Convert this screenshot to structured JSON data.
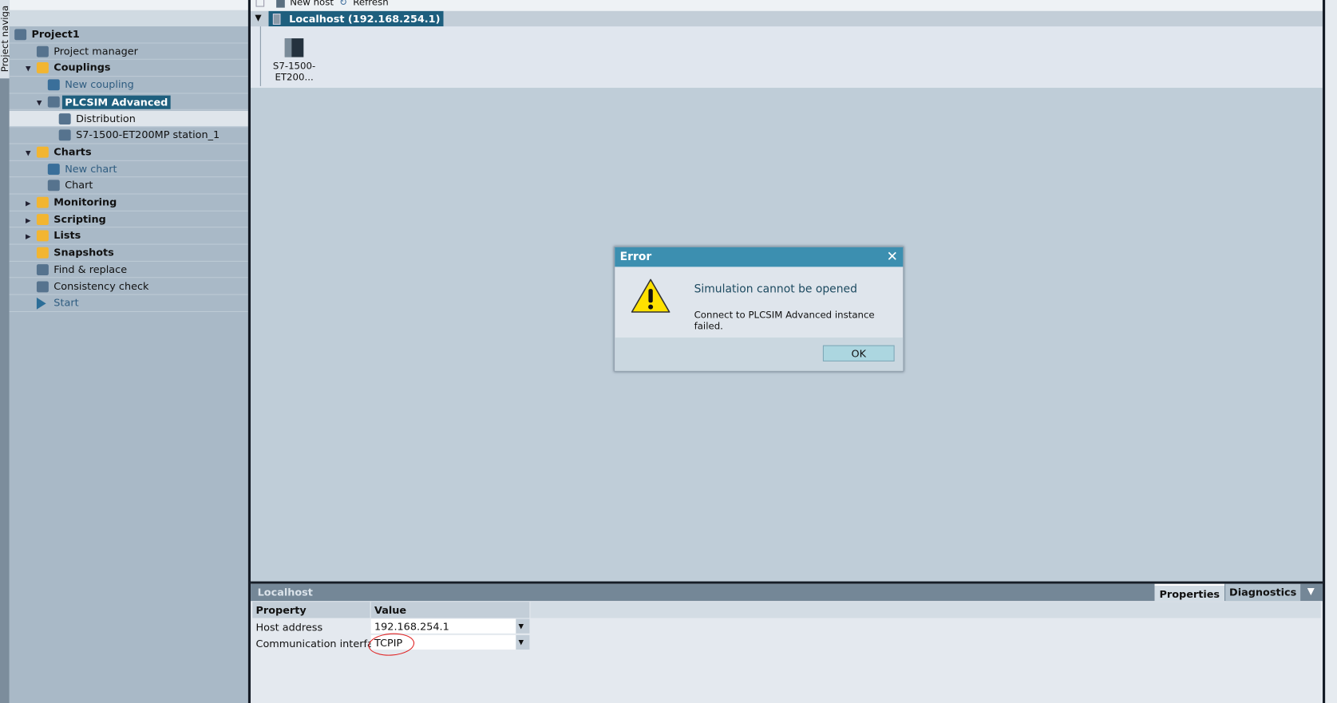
{
  "nav_tab": "Project naviga",
  "tree": [
    {
      "label": "Project1",
      "level": 0,
      "bold": true,
      "icon": "project-icon",
      "arrow": ""
    },
    {
      "label": "Project manager",
      "level": 1,
      "icon": "project-manager-icon",
      "arrow": ""
    },
    {
      "label": "Couplings",
      "level": 1,
      "bold": true,
      "icon": "couplings-folder-icon",
      "arrow": "expanded"
    },
    {
      "label": "New coupling",
      "level": 2,
      "blue": true,
      "icon": "new-coupling-icon",
      "arrow": ""
    },
    {
      "label": "PLCSIM Advanced",
      "level": 2,
      "bold": true,
      "selected": true,
      "icon": "plcsim-icon",
      "arrow": "expanded"
    },
    {
      "label": "Distribution",
      "level": 3,
      "highlight": true,
      "icon": "distribution-icon",
      "arrow": ""
    },
    {
      "label": "S7-1500-ET200MP station_1",
      "level": 3,
      "icon": "station-icon",
      "arrow": ""
    },
    {
      "label": "Charts",
      "level": 1,
      "bold": true,
      "icon": "charts-folder-icon",
      "arrow": "expanded"
    },
    {
      "label": "New chart",
      "level": 2,
      "blue": true,
      "icon": "new-chart-icon",
      "arrow": ""
    },
    {
      "label": "Chart",
      "level": 2,
      "icon": "chart-icon",
      "arrow": ""
    },
    {
      "label": "Monitoring",
      "level": 1,
      "bold": true,
      "icon": "monitoring-folder-icon",
      "arrow": "collapsed"
    },
    {
      "label": "Scripting",
      "level": 1,
      "bold": true,
      "icon": "scripting-folder-icon",
      "arrow": "collapsed"
    },
    {
      "label": "Lists",
      "level": 1,
      "bold": true,
      "icon": "lists-folder-icon",
      "arrow": "collapsed"
    },
    {
      "label": "Snapshots",
      "level": 1,
      "bold": true,
      "icon": "snapshots-folder-icon",
      "arrow": ""
    },
    {
      "label": "Find & replace",
      "level": 1,
      "icon": "find-replace-icon",
      "arrow": ""
    },
    {
      "label": "Consistency check",
      "level": 1,
      "icon": "consistency-check-icon",
      "arrow": ""
    },
    {
      "label": "Start",
      "level": 1,
      "blue": true,
      "icon": "start-icon",
      "arrow": ""
    }
  ],
  "toolbar": {
    "new_host": "New host",
    "refresh": "Refresh"
  },
  "host": {
    "label": "Localhost (192.168.254.1)",
    "device_line1": "S7-1500-",
    "device_line2": "ET200..."
  },
  "bottom": {
    "title": "Localhost",
    "tabs": [
      "Properties",
      "Diagnostics"
    ],
    "headers": [
      "Property",
      "Value"
    ],
    "rows": [
      {
        "property": "Host address",
        "value": "192.168.254.1"
      },
      {
        "property": "Communication interface",
        "value": "TCPIP"
      }
    ]
  },
  "dialog": {
    "title": "Error",
    "heading": "Simulation cannot be opened",
    "message": "Connect to PLCSIM Advanced instance failed.",
    "ok": "OK"
  },
  "colors": {
    "accent": "#1e5f7e",
    "dialog_title": "#3c8fb0"
  }
}
